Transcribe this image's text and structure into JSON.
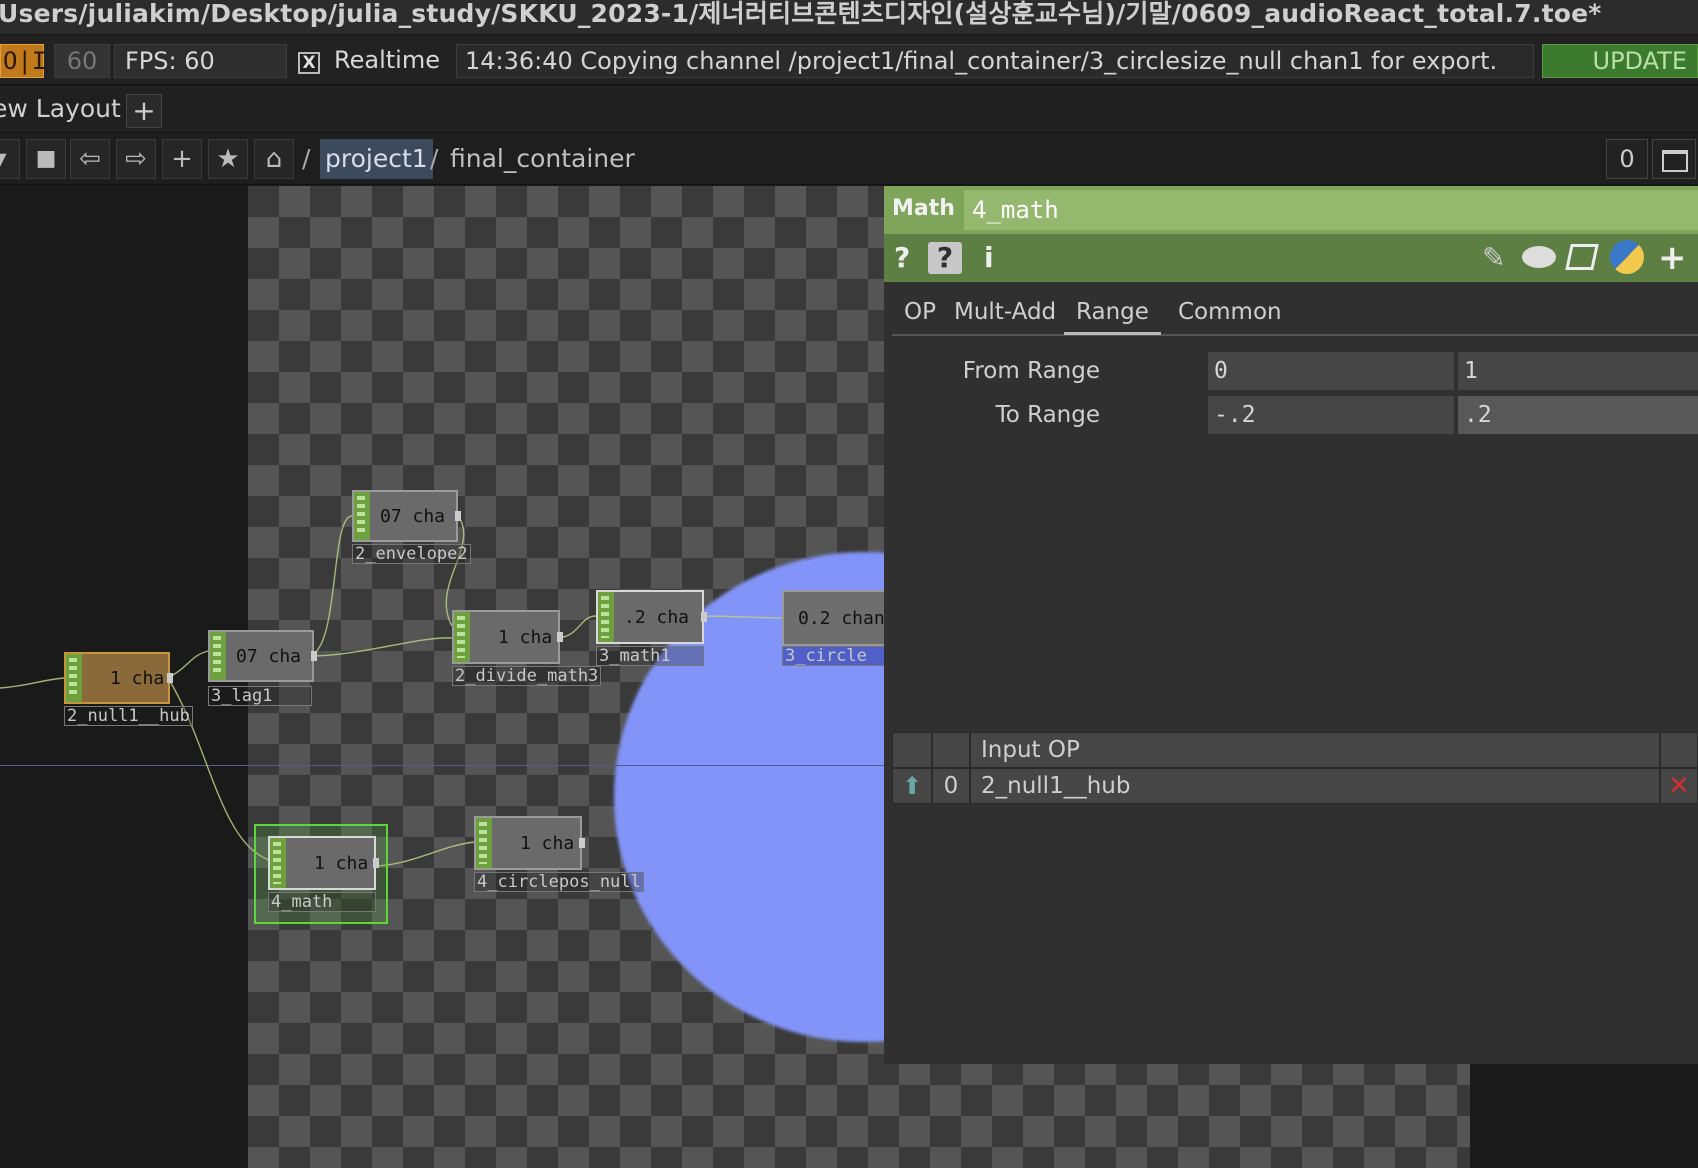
{
  "window": {
    "title": "Users/juliakim/Desktop/julia_study/SKKU_2023-1/제너러티브콘텐츠디자인(설상훈교수님)/기말/0609_audioReact_total.7.toe*"
  },
  "status": {
    "oi": "O|I",
    "fps_target": "60",
    "fps_label": "FPS:  60",
    "realtime_check": "X",
    "realtime_label": "Realtime",
    "log": "14:36:40 Copying channel /project1/final_container/3_circlesize_null chan1 for export.",
    "update": "UPDATE"
  },
  "layout": {
    "label": "ew Layout",
    "add": "+"
  },
  "nav": {
    "stop": "■",
    "back": "⇦",
    "forward": "⇨",
    "add": "+",
    "star": "★",
    "home": "⌂",
    "sep": "/",
    "crumb1": "project1",
    "crumb2": "final_container",
    "zoom": "0"
  },
  "nodes": [
    {
      "id": "null1",
      "value": "1 cha",
      "label": "2_null1__hub"
    },
    {
      "id": "lag1",
      "value": "07 cha",
      "label": "3_lag1"
    },
    {
      "id": "envelope2",
      "value": "07 cha",
      "label": "2_envelope2"
    },
    {
      "id": "divide",
      "value": "1 cha",
      "label": "2_divide_math3"
    },
    {
      "id": "math1",
      "value": ".2 cha",
      "label": "3_math1"
    },
    {
      "id": "circlesize",
      "value": "0.2 chan",
      "label": "3_circle"
    },
    {
      "id": "math4",
      "value": "1 cha",
      "label": "4_math"
    },
    {
      "id": "circlepos",
      "value": "1 cha",
      "label": "4_circlepos_null"
    }
  ],
  "param": {
    "type": "Math",
    "name": "4_math",
    "tools": {
      "help": "?",
      "py_help": "?",
      "info": "i",
      "add": "+"
    },
    "tabs": [
      "OP",
      "Mult-Add",
      "Range",
      "Common"
    ],
    "active_tab": "Range",
    "from_range": {
      "label": "From Range",
      "v1": "0",
      "v2": "1"
    },
    "to_range": {
      "label": "To Range",
      "v1": "-.2",
      "v2": ".2"
    },
    "input_table": {
      "header": "Input OP",
      "row_index": "0",
      "row_value": "2_null1__hub"
    }
  },
  "colors": {
    "param_header": "#7fa55a",
    "node_green": "#6fa040",
    "update_green": "#3c7a2e",
    "circle": "#8394f8"
  }
}
